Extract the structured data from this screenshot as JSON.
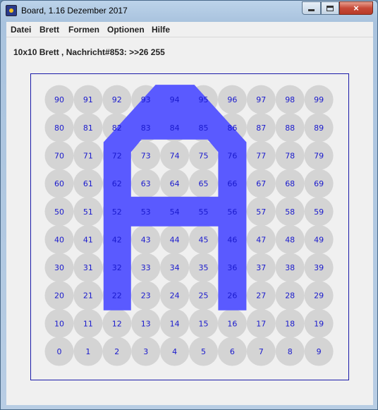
{
  "window": {
    "title": "Board, 1.16 Dezember 2017",
    "controls": {
      "minimize": "minimize",
      "maximize": "maximize",
      "close": "×"
    }
  },
  "menu": [
    "Datei",
    "Brett",
    "Formen",
    "Optionen",
    "Hilfe"
  ],
  "status_text": "10x10 Brett , Nachricht#853: >>26 255",
  "board": {
    "rows": 10,
    "cols": 10,
    "cell_fill": "#d4d4d4",
    "number_color": "#1a1acd",
    "border_color": "#1a1aa8",
    "glyph_color": "#5a5aff",
    "glyph": "A",
    "labels_bottom_to_top": [
      [
        "0",
        "1",
        "2",
        "3",
        "4",
        "5",
        "6",
        "7",
        "8",
        "9"
      ],
      [
        "10",
        "11",
        "12",
        "13",
        "14",
        "15",
        "16",
        "17",
        "18",
        "19"
      ],
      [
        "20",
        "21",
        "22",
        "23",
        "24",
        "25",
        "26",
        "27",
        "28",
        "29"
      ],
      [
        "30",
        "31",
        "32",
        "33",
        "34",
        "35",
        "36",
        "37",
        "38",
        "39"
      ],
      [
        "40",
        "41",
        "42",
        "43",
        "44",
        "45",
        "46",
        "47",
        "48",
        "49"
      ],
      [
        "50",
        "51",
        "52",
        "53",
        "54",
        "55",
        "56",
        "57",
        "58",
        "59"
      ],
      [
        "60",
        "61",
        "62",
        "63",
        "64",
        "65",
        "66",
        "67",
        "68",
        "69"
      ],
      [
        "70",
        "71",
        "72",
        "73",
        "74",
        "75",
        "76",
        "77",
        "78",
        "79"
      ],
      [
        "80",
        "81",
        "82",
        "83",
        "84",
        "85",
        "86",
        "87",
        "88",
        "89"
      ],
      [
        "90",
        "91",
        "92",
        "93",
        "94",
        "95",
        "96",
        "97",
        "98",
        "99"
      ]
    ]
  }
}
